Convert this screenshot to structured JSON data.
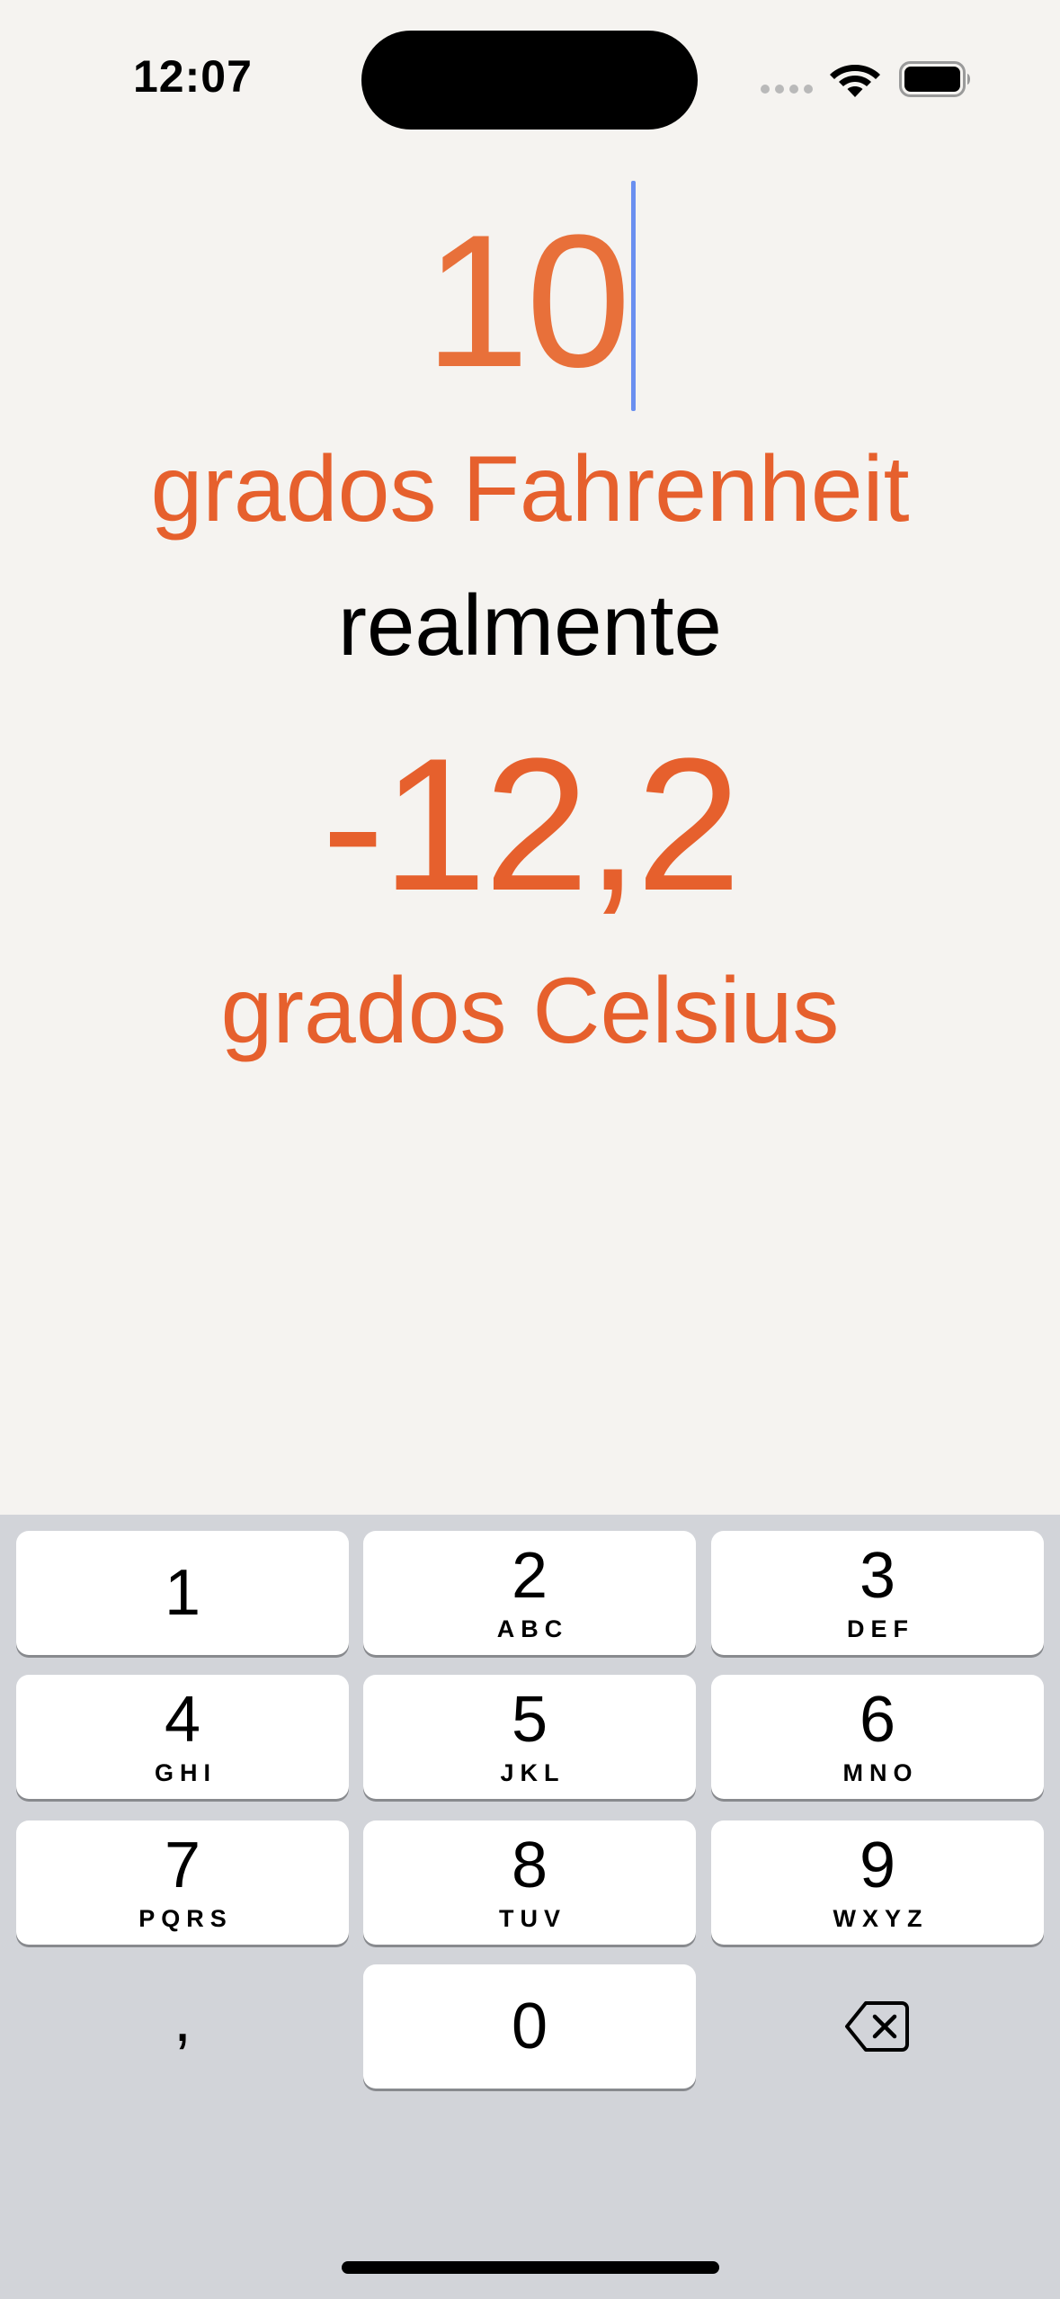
{
  "status_bar": {
    "time": "12:07",
    "icons": [
      "signal-icon",
      "wifi-icon",
      "battery-icon"
    ]
  },
  "converter": {
    "input_value": "10",
    "from_unit": "grados Fahrenheit",
    "connector": "realmente",
    "result_value": "-12,2",
    "to_unit": "grados Celsius"
  },
  "keypad": {
    "keys": [
      {
        "digit": "1",
        "letters": ""
      },
      {
        "digit": "2",
        "letters": "ABC"
      },
      {
        "digit": "3",
        "letters": "DEF"
      },
      {
        "digit": "4",
        "letters": "GHI"
      },
      {
        "digit": "5",
        "letters": "JKL"
      },
      {
        "digit": "6",
        "letters": "MNO"
      },
      {
        "digit": "7",
        "letters": "PQRS"
      },
      {
        "digit": "8",
        "letters": "TUV"
      },
      {
        "digit": "9",
        "letters": "WXYZ"
      },
      {
        "digit": "0",
        "letters": ""
      }
    ],
    "decimal_key": ",",
    "delete_icon": "backspace-icon"
  },
  "colors": {
    "accent": "#e6602d",
    "input": "#e8703a",
    "caret": "#6a8ff0",
    "background": "#f5f3f0",
    "keyboard_background": "#d2d4d9"
  }
}
